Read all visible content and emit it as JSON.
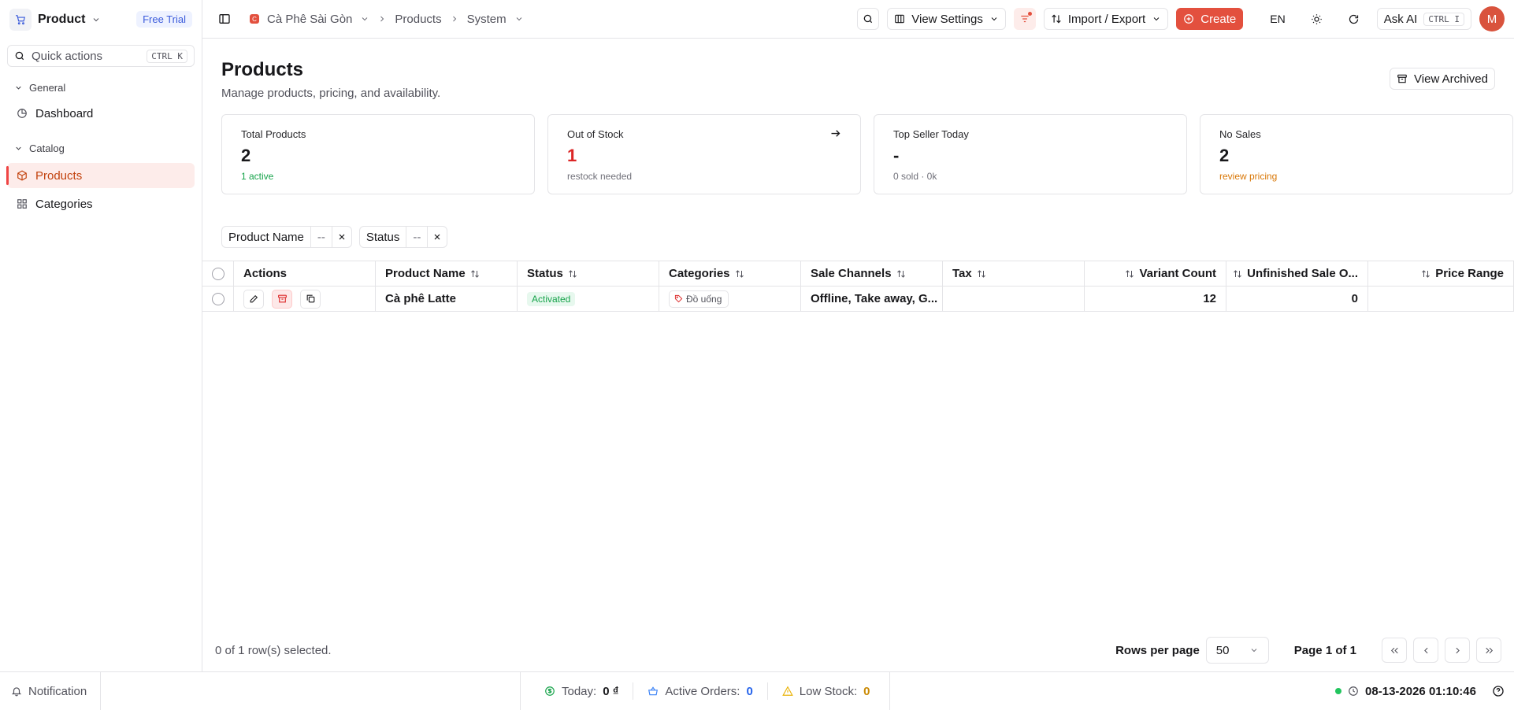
{
  "app": {
    "name": "Product",
    "trial_label": "Free Trial"
  },
  "quick_actions": {
    "placeholder": "Quick actions",
    "shortcut": "CTRL K"
  },
  "sidebar": {
    "groups": [
      {
        "label": "General",
        "items": [
          {
            "label": "Dashboard",
            "icon": "pie-chart-icon"
          }
        ]
      },
      {
        "label": "Catalog",
        "items": [
          {
            "label": "Products",
            "icon": "box-icon",
            "active": true
          },
          {
            "label": "Categories",
            "icon": "grid-icon"
          }
        ]
      }
    ]
  },
  "header": {
    "shop": "Cà Phê Sài Gòn",
    "breadcrumbs": [
      "Products",
      "System"
    ],
    "view_settings": "View Settings",
    "import_export": "Import / Export",
    "create": "Create",
    "lang": "EN",
    "ask_ai": "Ask AI",
    "ask_ai_shortcut": "CTRL I",
    "avatar": "M"
  },
  "page": {
    "title": "Products",
    "subtitle": "Manage products, pricing, and availability.",
    "view_archived": "View Archived"
  },
  "stats": [
    {
      "label": "Total Products",
      "value": "2",
      "sub": "1 active",
      "color": "#16a34a",
      "sub_color": "#16a34a"
    },
    {
      "label": "Out of Stock",
      "value": "1",
      "sub": "restock needed",
      "color": "#dc2626",
      "sub_color": "#71717a"
    },
    {
      "label": "Top Seller Today",
      "value": "-",
      "sub": "0 sold · 0k",
      "color": "#18181b",
      "sub_color": "#71717a"
    },
    {
      "label": "No Sales",
      "value": "2",
      "sub": "review pricing",
      "color": "#18181b",
      "sub_color": "#d97706"
    }
  ],
  "filters": [
    {
      "label": "Product Name",
      "value": "--"
    },
    {
      "label": "Status",
      "value": "--"
    }
  ],
  "table": {
    "columns": [
      "Actions",
      "Product Name",
      "Status",
      "Categories",
      "Sale Channels",
      "Tax",
      "Variant Count",
      "Unfinished Sale O...",
      "Price Range"
    ],
    "rows": [
      {
        "name": "Cà phê Latte",
        "status": "Activated",
        "category": "Đồ uống",
        "channels": "Offline, Take away, G...",
        "tax": "",
        "variants": "12",
        "unfinished": "0",
        "price_range": ""
      }
    ]
  },
  "footer": {
    "selection": "0 of 1 row(s) selected.",
    "rows_per_page_label": "Rows per page",
    "rows_per_page": "50",
    "page_info": "Page 1 of 1"
  },
  "statusbar": {
    "notification": "Notification",
    "today_label": "Today:",
    "today_value": "0 ₫",
    "orders_label": "Active Orders:",
    "orders_value": "0",
    "low_label": "Low Stock:",
    "low_value": "0",
    "datetime": "08-13-2026 01:10:46"
  },
  "colors": {
    "accent": "#e3503e",
    "active_bg": "#fdecea"
  }
}
